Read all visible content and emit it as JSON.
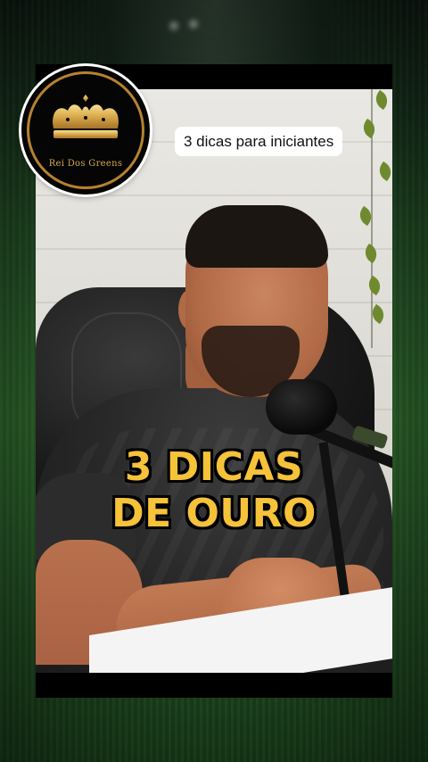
{
  "logo": {
    "brand_name": "Rei Dos Greens",
    "icon": "crown-icon"
  },
  "overlay": {
    "title_pill": "3 dicas para iniciantes"
  },
  "video": {
    "caption_line1": "3 DICAS",
    "caption_line2": "DE OURO"
  },
  "colors": {
    "caption_yellow": "#f6c23a",
    "logo_gold": "#d6a94c",
    "background_green": "#1f4a22"
  }
}
